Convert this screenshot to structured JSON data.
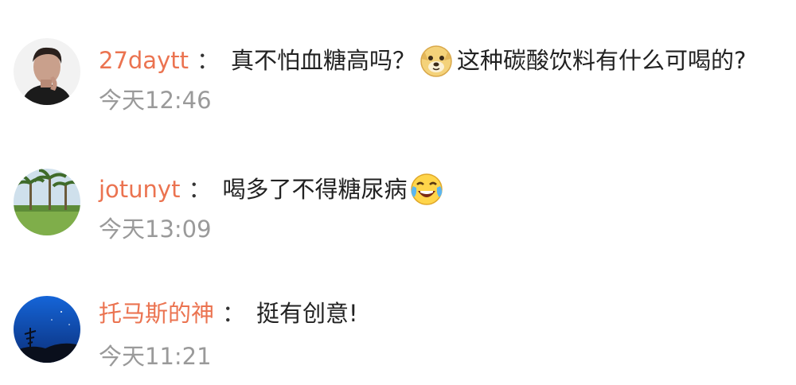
{
  "comments": [
    {
      "username": "27daytt",
      "separator": "：",
      "text_before": "真不怕血糖高吗？",
      "emoji": "doge-emoji",
      "text_after": "这种碳酸饮料有什么可喝的?",
      "time": "今天12:46",
      "avatar": "portrait-photo-avatar"
    },
    {
      "username": "jotunyt",
      "separator": "：",
      "text_before": "喝多了不得糖尿病",
      "emoji": "laughing-crying-emoji",
      "text_after": "",
      "time": "今天13:09",
      "avatar": "palm-trees-avatar"
    },
    {
      "username": "托马斯的神",
      "separator": "：",
      "text_before": "挺有创意!",
      "emoji": "",
      "text_after": "",
      "time": "今天11:21",
      "avatar": "night-sky-avatar"
    }
  ],
  "colors": {
    "username": "#eb7350",
    "text": "#222222",
    "time": "#9a9a9a"
  }
}
